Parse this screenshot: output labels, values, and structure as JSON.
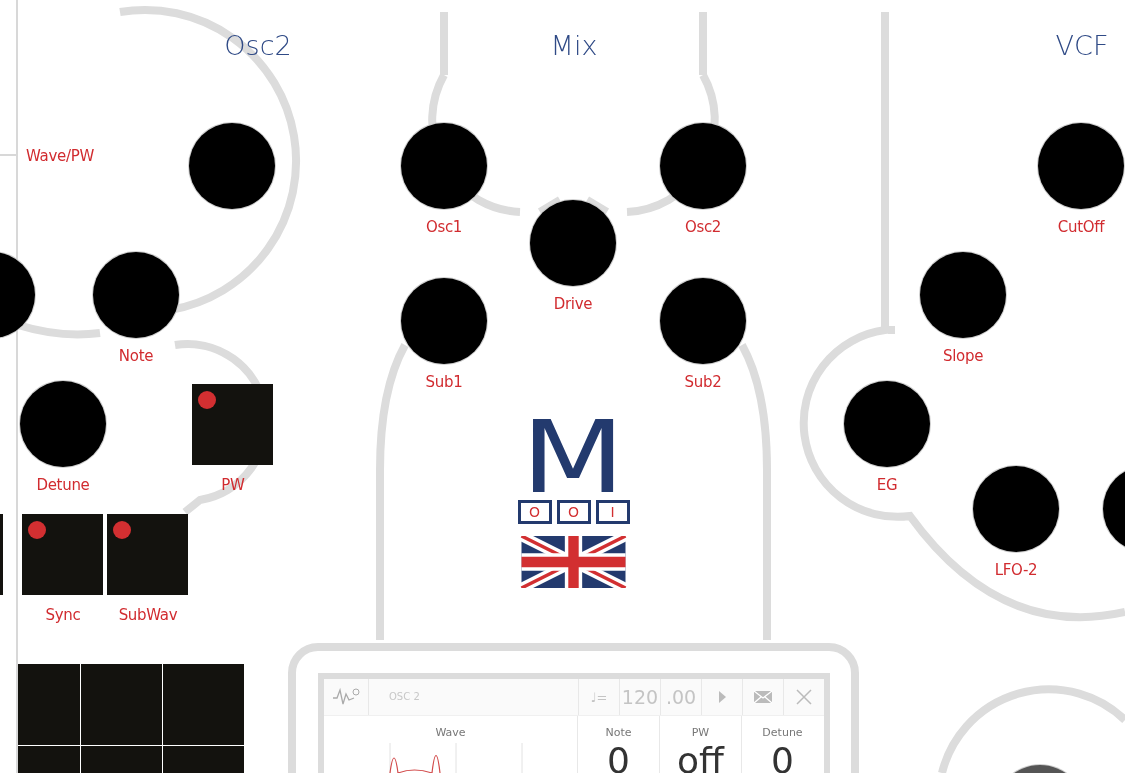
{
  "sections": [
    {
      "title": "Osc2"
    },
    {
      "title": "Mix"
    },
    {
      "title": "VCF"
    }
  ],
  "loose_label": "Wave/PW",
  "knobs": [
    {
      "label": "Note"
    },
    {
      "label": "Detune"
    },
    {
      "label": "Osc1"
    },
    {
      "label": "Drive"
    },
    {
      "label": "Osc2"
    },
    {
      "label": "Sub1"
    },
    {
      "label": "Sub2"
    },
    {
      "label": "CutOff"
    },
    {
      "label": "Slope"
    },
    {
      "label": "EG"
    },
    {
      "label": "LFO-2"
    }
  ],
  "switches": [
    {
      "label": "PW",
      "on": true
    },
    {
      "label": "Sync",
      "on": true
    },
    {
      "label": "SubWav",
      "on": true
    }
  ],
  "logo": {
    "letter": "M",
    "digits": [
      "O",
      "O",
      "I"
    ]
  },
  "display": {
    "title": "OSC 2",
    "tempo_symbol": "♩=",
    "tempo": "120",
    "tempo_fraction": ".00",
    "columns": [
      {
        "heading": "Wave"
      },
      {
        "heading": "Note",
        "value": "0"
      },
      {
        "heading": "PW",
        "value": "off"
      },
      {
        "heading": "Detune",
        "value": "0"
      }
    ]
  }
}
